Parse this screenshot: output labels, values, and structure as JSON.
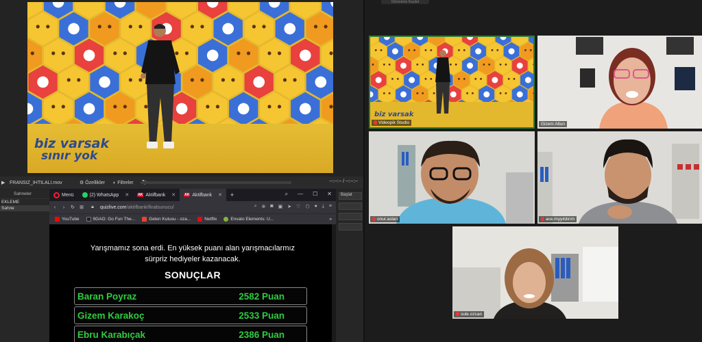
{
  "studio": {
    "logo_line1": "biz varsak",
    "logo_line2": "sınır yok",
    "media_file": "FRANSIZ_IHTILALI.mov",
    "settings_label": "Özellikler",
    "filters_label": "Filtreler",
    "time_display": "--:--:-- / --:--:--",
    "scenes_header": "Sahneler",
    "scenes": [
      "EKLEME",
      "Sahne"
    ],
    "mixer_button": "Başlat"
  },
  "browser": {
    "menu_label": "Menü",
    "tabs": [
      {
        "label": "(2) WhatsApp"
      },
      {
        "label": "Aktifbank"
      },
      {
        "label": "Aktifbank"
      }
    ],
    "url_host": "quizlive.com",
    "url_path": "/aktifbank/finalsunucu/",
    "bookmarks": [
      {
        "label": "YouTube",
        "color": "#ff0000"
      },
      {
        "label": "9GAG: Go Fun The...",
        "color": "#222222"
      },
      {
        "label": "Gelen Kutusu - ozа...",
        "color": "#ea4335"
      },
      {
        "label": "Netflix",
        "color": "#e50914"
      },
      {
        "label": "Envato Elements: U...",
        "color": "#82b541"
      }
    ],
    "message_line1": "Yarışmamız sona erdi. En yüksek puanı alan yarışmacılarmız",
    "message_line2": "sürpriz hediyeler kazanacak.",
    "results_title": "SONUÇLAR",
    "results": [
      {
        "name": "Baran Poyraz",
        "score": "2582 Puan"
      },
      {
        "name": "Gizem Karakoç",
        "score": "2533 Puan"
      },
      {
        "name": "Ebru Karabıçak",
        "score": "2386 Puan"
      }
    ]
  },
  "meeting": {
    "top_label": "Görünümü Kaydet",
    "participants": [
      {
        "name": "Videopik Studio"
      },
      {
        "name": "Gizem Altun"
      },
      {
        "name": "onur.aslan"
      },
      {
        "name": "ace.myyıldırım"
      },
      {
        "name": "sule.ozcan"
      }
    ],
    "active_speaker_color": "#2e7d32"
  }
}
